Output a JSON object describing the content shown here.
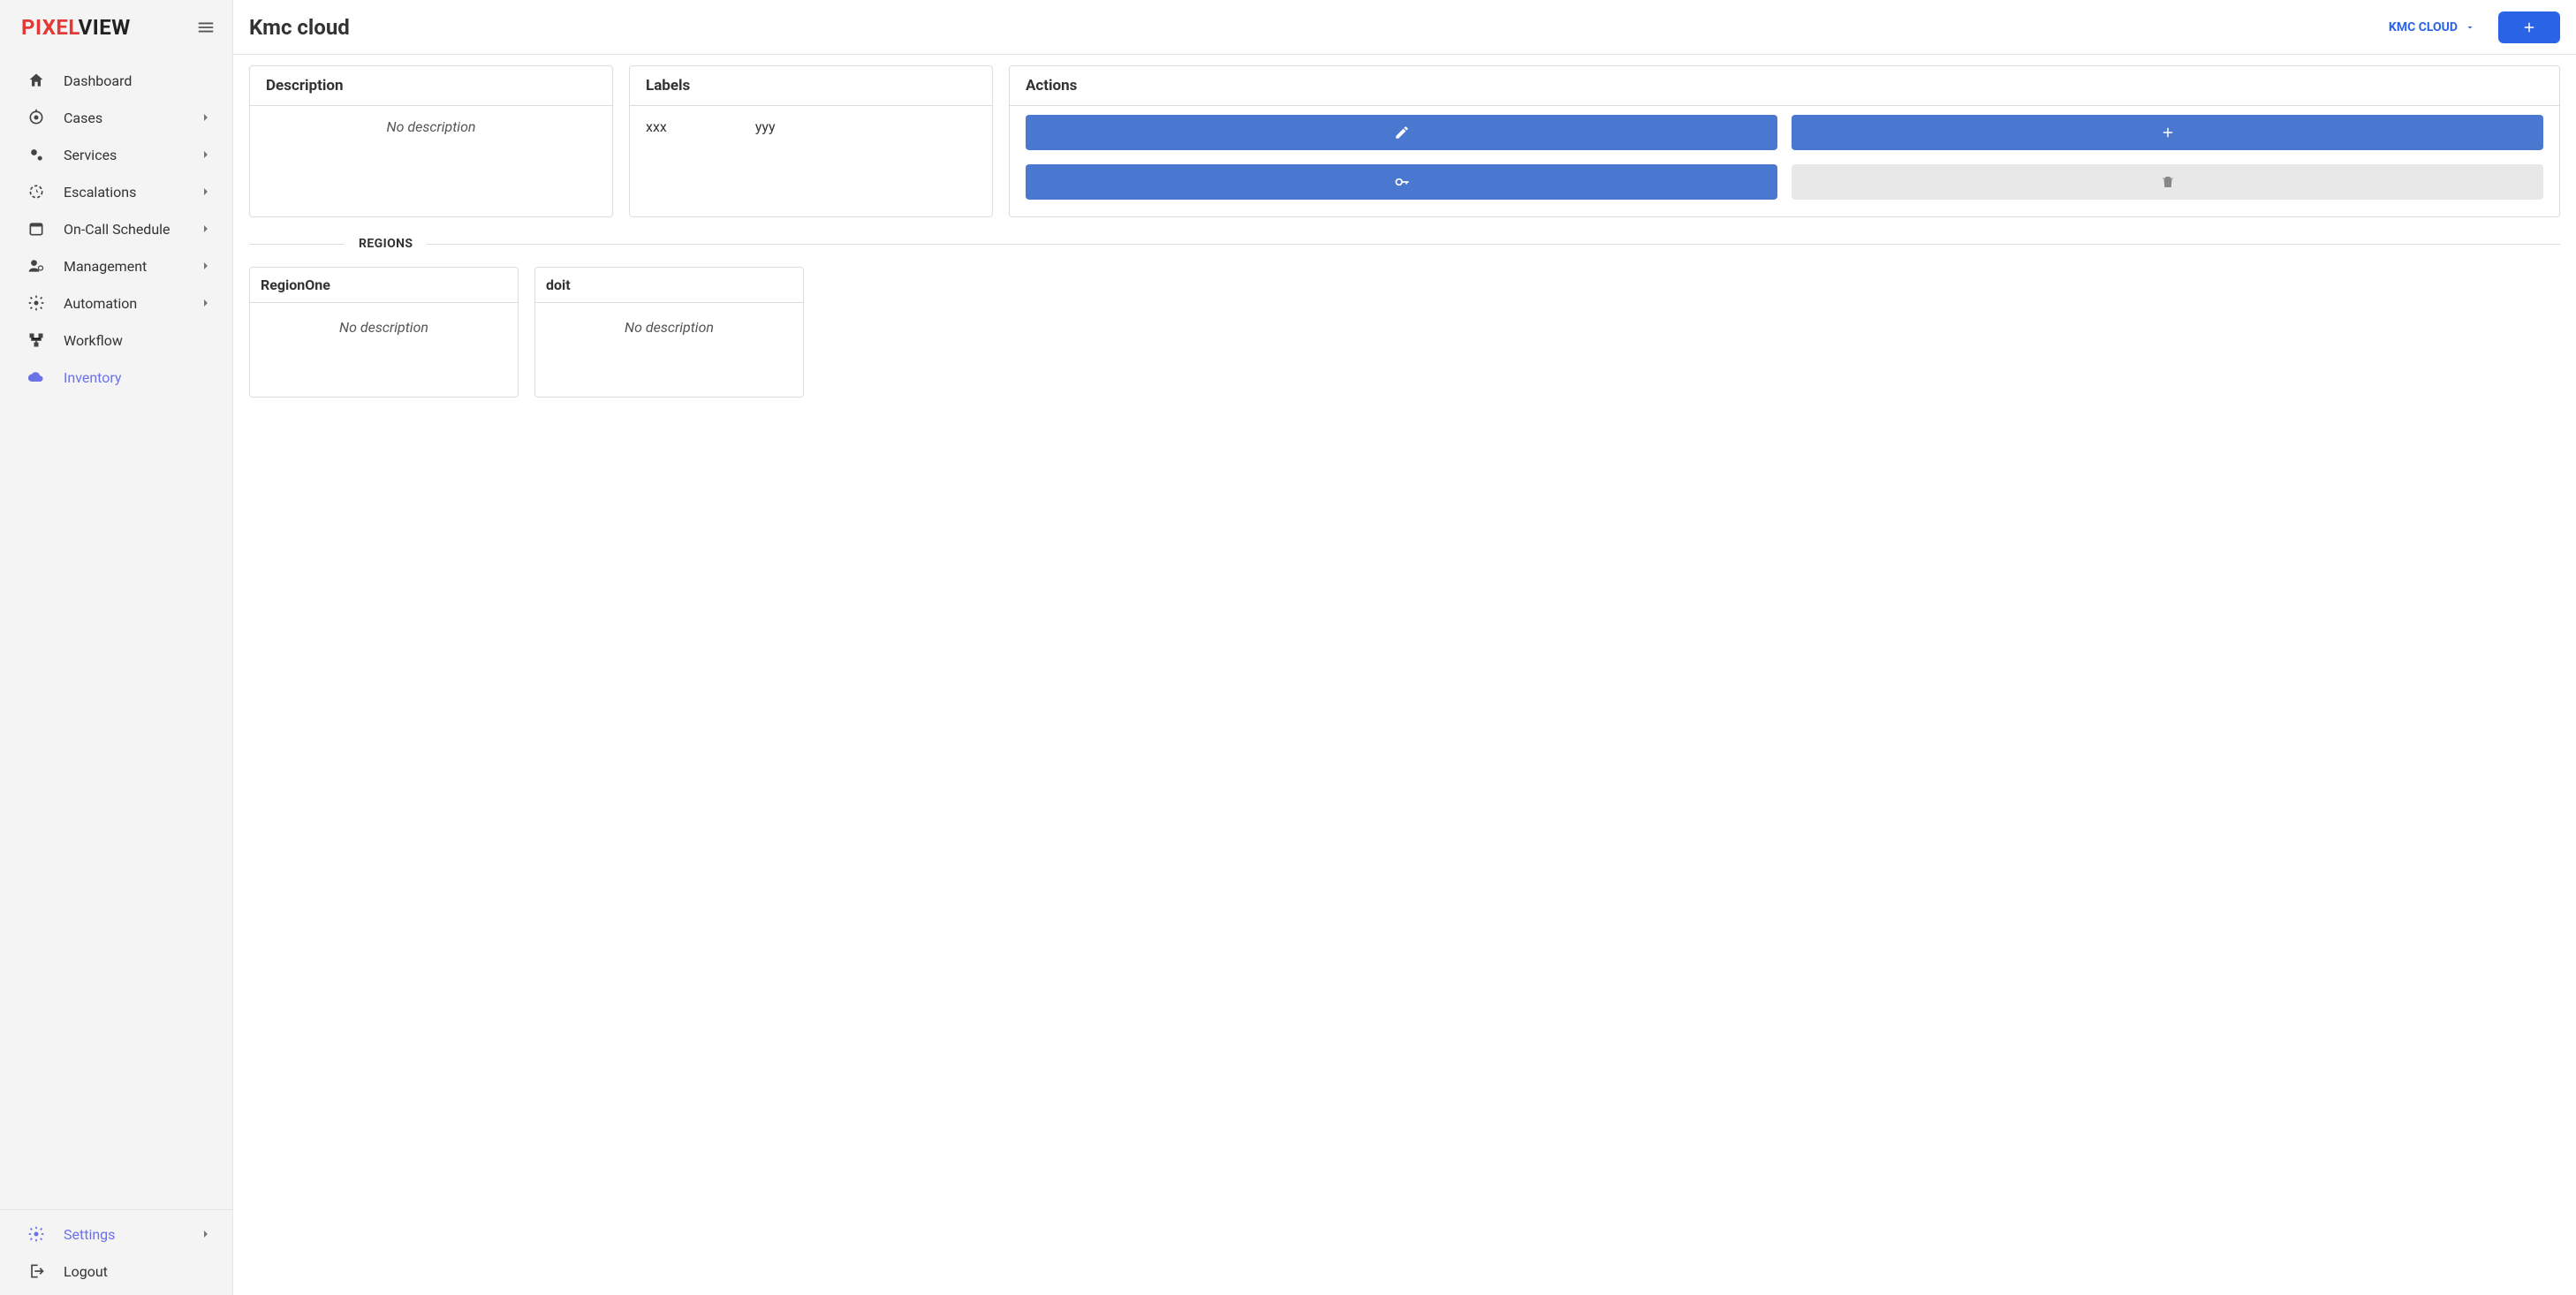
{
  "brand": {
    "part1": "PIXEL",
    "part2": "VIEW"
  },
  "sidebar": {
    "items": [
      {
        "id": "dashboard",
        "label": "Dashboard",
        "expandable": false
      },
      {
        "id": "cases",
        "label": "Cases",
        "expandable": true
      },
      {
        "id": "services",
        "label": "Services",
        "expandable": true
      },
      {
        "id": "escalations",
        "label": "Escalations",
        "expandable": true
      },
      {
        "id": "oncall",
        "label": "On-Call Schedule",
        "expandable": true
      },
      {
        "id": "management",
        "label": "Management",
        "expandable": true
      },
      {
        "id": "automation",
        "label": "Automation",
        "expandable": true
      },
      {
        "id": "workflow",
        "label": "Workflow",
        "expandable": false
      },
      {
        "id": "inventory",
        "label": "Inventory",
        "expandable": false,
        "active": true
      }
    ],
    "settings_label": "Settings",
    "logout_label": "Logout"
  },
  "header": {
    "title": "Kmc cloud",
    "dropdown_label": "KMC CLOUD"
  },
  "cards": {
    "description": {
      "title": "Description",
      "body": "No description"
    },
    "labels": {
      "title": "Labels",
      "items": [
        "xxx",
        "yyy"
      ]
    },
    "actions": {
      "title": "Actions"
    }
  },
  "regions": {
    "section_label": "REGIONS",
    "items": [
      {
        "name": "RegionOne",
        "desc": "No description"
      },
      {
        "name": "doit",
        "desc": "No description"
      }
    ]
  }
}
